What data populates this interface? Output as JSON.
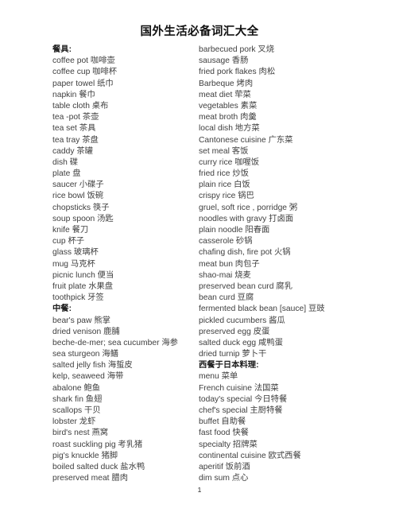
{
  "document": {
    "title": "国外生活必备词汇大全",
    "page_number": "1"
  },
  "left_column": [
    {
      "text": "餐具:",
      "type": "section"
    },
    {
      "text": "coffee pot  咖啡壶",
      "type": "entry"
    },
    {
      "text": "coffee cup  咖啡杯",
      "type": "entry"
    },
    {
      "text": "paper towel  纸巾",
      "type": "entry"
    },
    {
      "text": "napkin  餐巾",
      "type": "entry"
    },
    {
      "text": "table cloth  桌布",
      "type": "entry"
    },
    {
      "text": "tea -pot  茶壶",
      "type": "entry"
    },
    {
      "text": "tea set  茶具",
      "type": "entry"
    },
    {
      "text": "tea tray  茶盘",
      "type": "entry"
    },
    {
      "text": "caddy  茶罐",
      "type": "entry"
    },
    {
      "text": "dish  碟",
      "type": "entry"
    },
    {
      "text": "plate  盘",
      "type": "entry"
    },
    {
      "text": "saucer  小碟子",
      "type": "entry"
    },
    {
      "text": "rice bowl  饭碗",
      "type": "entry"
    },
    {
      "text": "chopsticks  筷子",
      "type": "entry"
    },
    {
      "text": "soup spoon  汤匙",
      "type": "entry"
    },
    {
      "text": "knife  餐刀",
      "type": "entry"
    },
    {
      "text": "cup  杯子",
      "type": "entry"
    },
    {
      "text": "glass  玻璃杯",
      "type": "entry"
    },
    {
      "text": "mug  马克杯",
      "type": "entry"
    },
    {
      "text": "picnic lunch  便当",
      "type": "entry"
    },
    {
      "text": "fruit plate  水果盘",
      "type": "entry"
    },
    {
      "text": "toothpick  牙签",
      "type": "entry"
    },
    {
      "text": "中餐:",
      "type": "section"
    },
    {
      "text": "bear's paw  熊掌",
      "type": "entry"
    },
    {
      "text": "dried venison  鹿脯",
      "type": "entry"
    },
    {
      "text": "beche-de-mer; sea cucumber  海参",
      "type": "entry"
    },
    {
      "text": "sea sturgeon  海鳝",
      "type": "entry"
    },
    {
      "text": "salted jelly fish  海蜇皮",
      "type": "entry"
    },
    {
      "text": "kelp, seaweed  海带",
      "type": "entry"
    },
    {
      "text": "abalone  鲍鱼",
      "type": "entry"
    },
    {
      "text": "shark fin  鱼翅",
      "type": "entry"
    },
    {
      "text": "scallops  干贝",
      "type": "entry"
    },
    {
      "text": "lobster  龙虾",
      "type": "entry"
    },
    {
      "text": "bird's nest  燕窝",
      "type": "entry"
    },
    {
      "text": "roast suckling pig  考乳猪",
      "type": "entry"
    },
    {
      "text": "pig's knuckle  猪脚",
      "type": "entry"
    },
    {
      "text": "boiled salted duck  盐水鸭",
      "type": "entry"
    },
    {
      "text": "preserved meat  腊肉",
      "type": "entry"
    }
  ],
  "right_column": [
    {
      "text": "barbecued pork  叉烧",
      "type": "entry"
    },
    {
      "text": "sausage  香肠",
      "type": "entry"
    },
    {
      "text": "fried pork flakes  肉松",
      "type": "entry"
    },
    {
      "text": "Barbeque  烤肉",
      "type": "entry"
    },
    {
      "text": "meat diet  荦菜",
      "type": "entry"
    },
    {
      "text": "vegetables  素菜",
      "type": "entry"
    },
    {
      "text": "meat broth  肉羹",
      "type": "entry"
    },
    {
      "text": "local dish  地方菜",
      "type": "entry"
    },
    {
      "text": "Cantonese cuisine  广东菜",
      "type": "entry"
    },
    {
      "text": "set meal  客饭",
      "type": "entry"
    },
    {
      "text": "curry rice  咖喔饭",
      "type": "entry"
    },
    {
      "text": "fried rice  炒饭",
      "type": "entry"
    },
    {
      "text": "plain rice  白饭",
      "type": "entry"
    },
    {
      "text": "crispy rice  锅巴",
      "type": "entry"
    },
    {
      "text": "gruel, soft rice , porridge  粥",
      "type": "entry"
    },
    {
      "text": "noodles with gravy  打卤面",
      "type": "entry"
    },
    {
      "text": "plain noodle  阳春面",
      "type": "entry"
    },
    {
      "text": "casserole  砂锅",
      "type": "entry"
    },
    {
      "text": "chafing dish, fire pot  火锅",
      "type": "entry"
    },
    {
      "text": "meat bun  肉包子",
      "type": "entry"
    },
    {
      "text": "shao-mai  烧麦",
      "type": "entry"
    },
    {
      "text": "preserved bean curd  腐乳",
      "type": "entry"
    },
    {
      "text": "bean curd  豆腐",
      "type": "entry"
    },
    {
      "text": "fermented black bean [sauce]  豆豉",
      "type": "entry"
    },
    {
      "text": "pickled cucumbers  酱瓜",
      "type": "entry"
    },
    {
      "text": "preserved egg  皮蛋",
      "type": "entry"
    },
    {
      "text": "salted duck egg  咸鸭蛋",
      "type": "entry"
    },
    {
      "text": "dried turnip  萝卜干",
      "type": "entry"
    },
    {
      "text": "西餐于日本料理:",
      "type": "section"
    },
    {
      "text": "menu  菜单",
      "type": "entry"
    },
    {
      "text": "French cuisine  法国菜",
      "type": "entry"
    },
    {
      "text": "today's special  今日特餐",
      "type": "entry"
    },
    {
      "text": "chef's special  主厨特餐",
      "type": "entry"
    },
    {
      "text": "buffet  自助餐",
      "type": "entry"
    },
    {
      "text": "fast food  快餐",
      "type": "entry"
    },
    {
      "text": "specialty  招牌菜",
      "type": "entry"
    },
    {
      "text": "continental cuisine  欧式西餐",
      "type": "entry"
    },
    {
      "text": "aperitif  饭前酒",
      "type": "entry"
    },
    {
      "text": "dim sum  点心",
      "type": "entry"
    }
  ]
}
